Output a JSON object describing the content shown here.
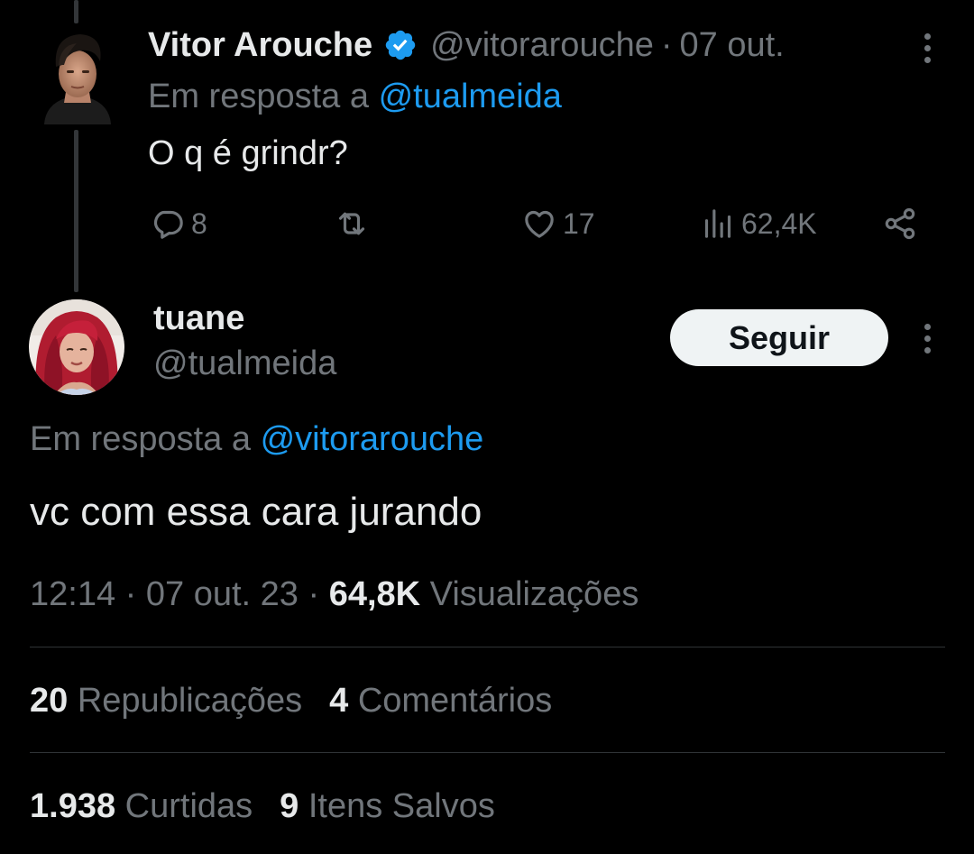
{
  "parent_tweet": {
    "author_name": "Vitor Arouche",
    "handle": "@vitorarouche",
    "separator": "·",
    "date": "07 out.",
    "replying_prefix": "Em resposta a",
    "replying_to": "@tualmeida",
    "text": "O q é grindr?",
    "actions": {
      "replies": "8",
      "likes": "17",
      "views": "62,4K"
    },
    "icons": [
      "reply-icon",
      "retweet-icon",
      "like-icon",
      "views-icon",
      "share-icon",
      "more-icon",
      "verified-icon"
    ]
  },
  "main_tweet": {
    "author_name": "tuane",
    "handle": "@tualmeida",
    "follow_label": "Seguir",
    "replying_prefix": "Em resposta a",
    "replying_to": "@vitorarouche",
    "text": "vc com essa cara jurando",
    "time": "12:14",
    "separator": "·",
    "date": "07 out. 23",
    "views_count": "64,8K",
    "views_label": "Visualizações",
    "stats": {
      "reposts_count": "20",
      "reposts_label": "Republicações",
      "comments_count": "4",
      "comments_label": "Comentários",
      "likes_count": "1.938",
      "likes_label": "Curtidas",
      "saves_count": "9",
      "saves_label": "Itens Salvos"
    }
  },
  "colors": {
    "background": "#000000",
    "text_primary": "#e7e9ea",
    "text_secondary": "#71767b",
    "accent": "#1d9bf0",
    "divider": "#2f3336",
    "button_bg": "#eff3f4"
  }
}
